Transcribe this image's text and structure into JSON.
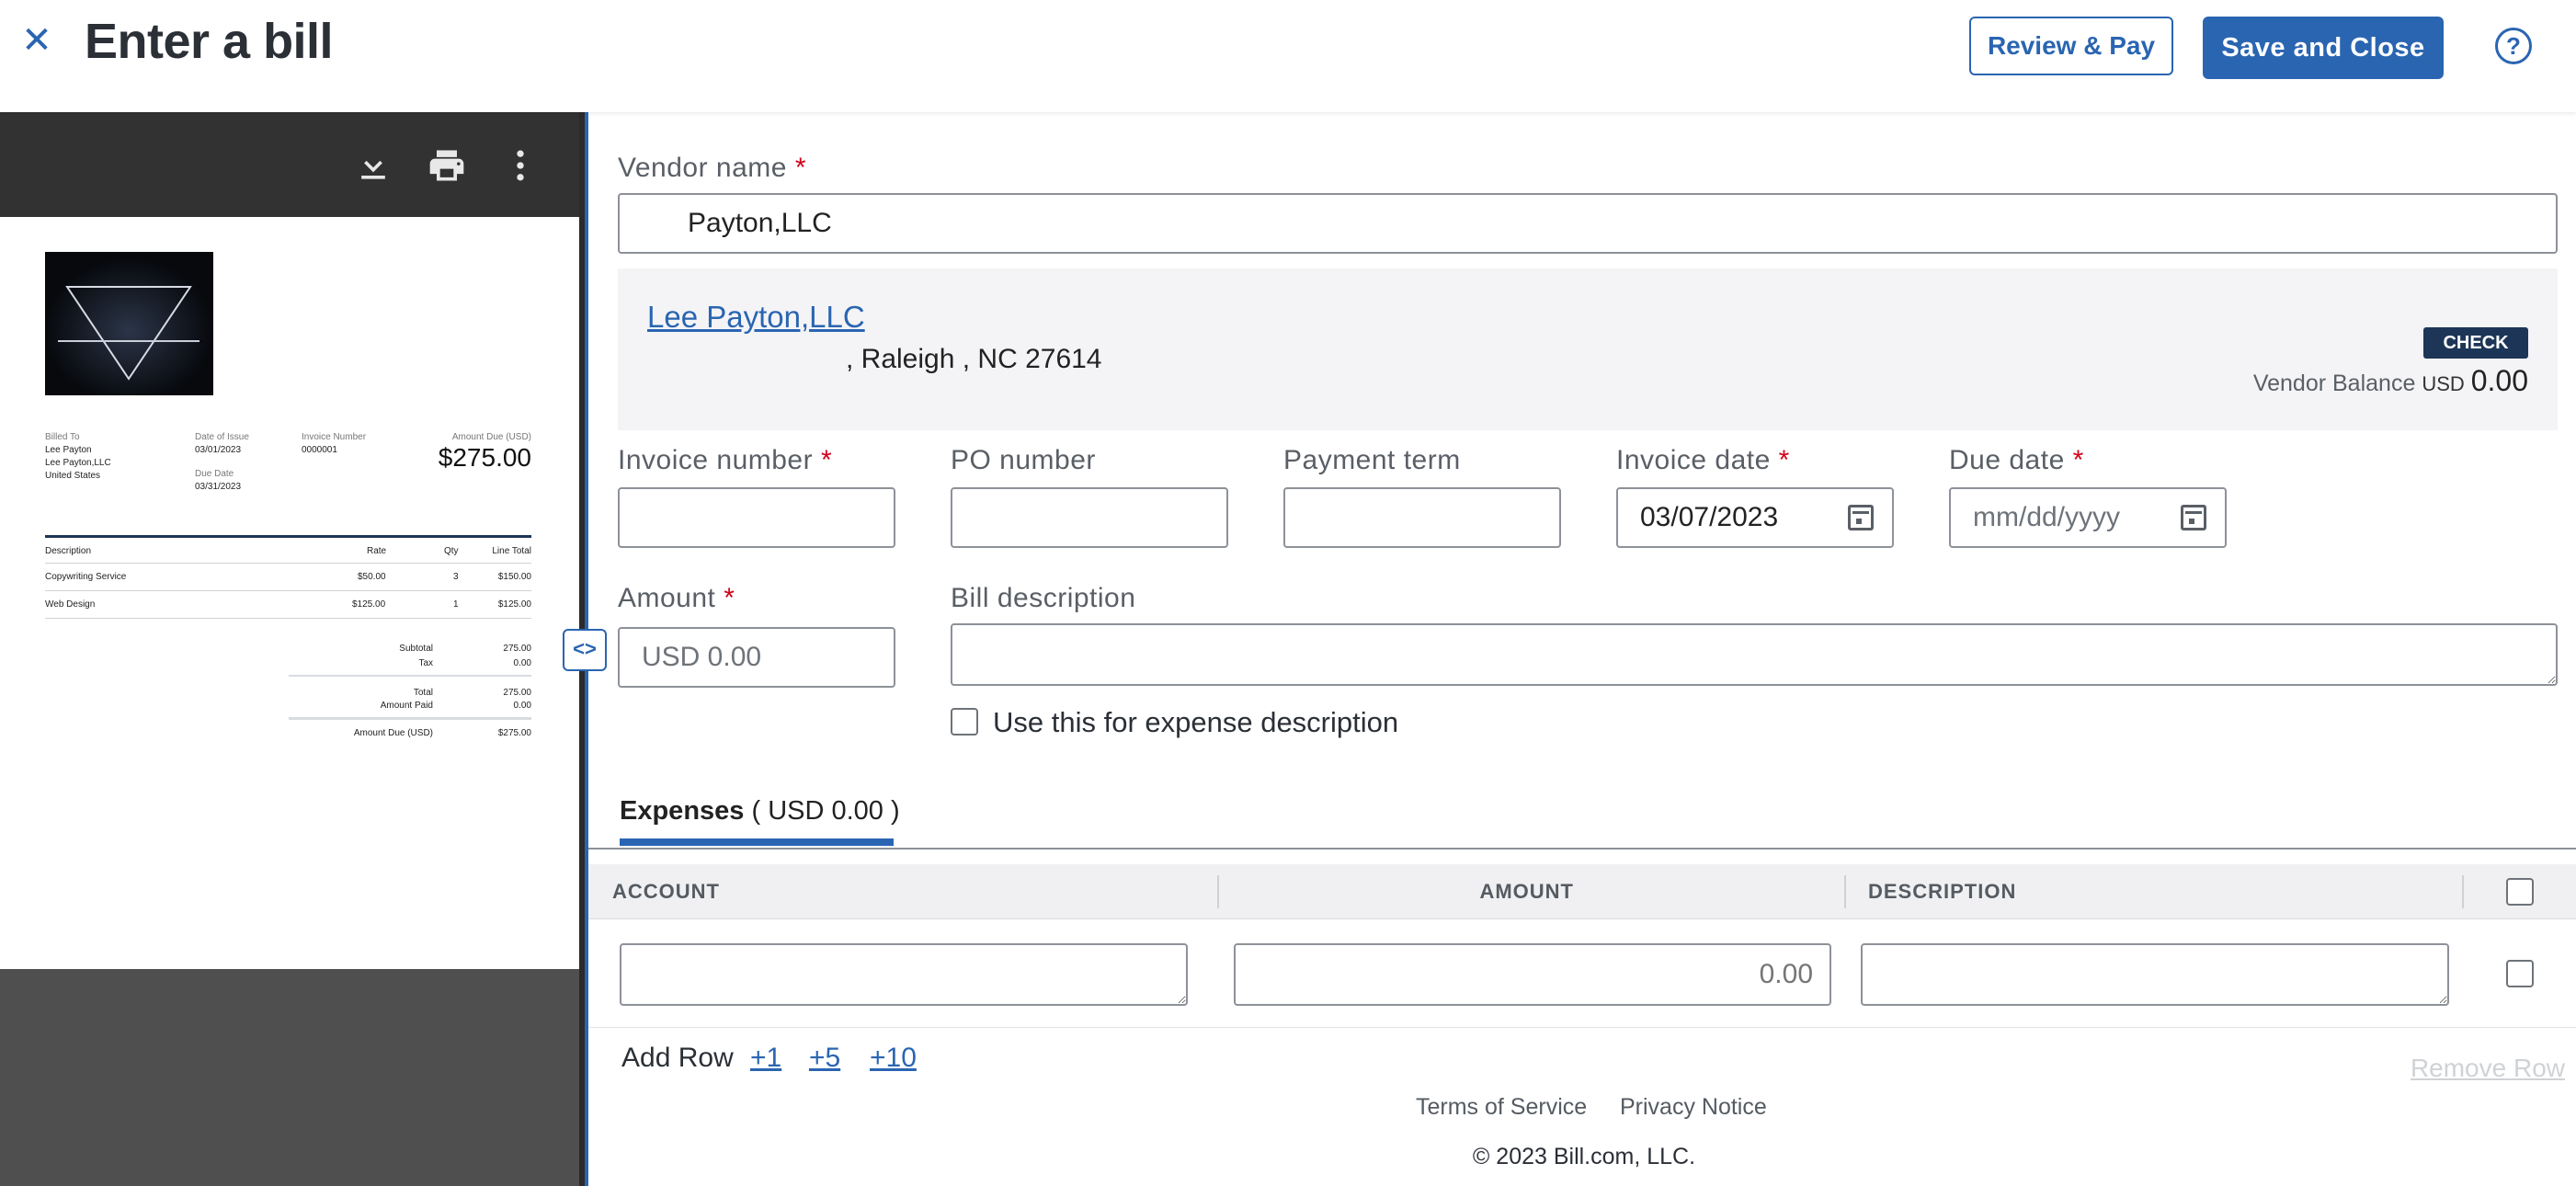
{
  "header": {
    "title": "Enter a bill",
    "review_pay": "Review & Pay",
    "save_close": "Save and Close"
  },
  "viewer": {
    "icons": [
      "download-icon",
      "print-icon",
      "more-vert-icon"
    ],
    "invoice": {
      "billed_to_label": "Billed To",
      "billed_to_lines": [
        "Lee Payton",
        "Lee Payton,LLC",
        "United States"
      ],
      "date_of_issue_label": "Date of Issue",
      "date_of_issue": "03/01/2023",
      "due_date_label": "Due Date",
      "due_date": "03/31/2023",
      "invoice_number_label": "Invoice Number",
      "invoice_number": "0000001",
      "amount_due_label": "Amount Due (USD)",
      "amount_due": "$275.00",
      "columns": [
        "Description",
        "Rate",
        "Qty",
        "Line Total"
      ],
      "items": [
        {
          "description": "Copywriting Service",
          "rate": "$50.00",
          "qty": "3",
          "total": "$150.00"
        },
        {
          "description": "Web Design",
          "rate": "$125.00",
          "qty": "1",
          "total": "$125.00"
        }
      ],
      "subtotal_label": "Subtotal",
      "subtotal": "275.00",
      "tax_label": "Tax",
      "tax": "0.00",
      "total_label": "Total",
      "total": "275.00",
      "amount_paid_label": "Amount Paid",
      "amount_paid": "0.00",
      "amount_due_footer_label": "Amount Due (USD)",
      "amount_due_footer": "$275.00"
    }
  },
  "form": {
    "vendor_name_label": "Vendor name",
    "vendor_name_value": "Payton,LLC",
    "vendor": {
      "name": "Lee Payton,LLC",
      "address": ", Raleigh , NC 27614",
      "badge": "CHECK",
      "balance_label": "Vendor Balance",
      "balance_currency": "USD",
      "balance_value": "0.00"
    },
    "invoice_number_label": "Invoice number",
    "po_number_label": "PO number",
    "payment_term_label": "Payment term",
    "invoice_date_label": "Invoice date",
    "invoice_date_value": "03/07/2023",
    "due_date_label": "Due date",
    "due_date_placeholder": "mm/dd/yyyy",
    "amount_label": "Amount",
    "amount_placeholder": "USD 0.00",
    "bill_description_label": "Bill description",
    "use_for_expense_label": "Use this for expense description",
    "required_mark": "*"
  },
  "expenses": {
    "tab_label": "Expenses",
    "tab_total": "( USD 0.00 )",
    "columns": {
      "account": "ACCOUNT",
      "amount": "AMOUNT",
      "description": "DESCRIPTION"
    },
    "row_amount_placeholder": "0.00",
    "add_row_label": "Add Row",
    "add_links": [
      "+1",
      "+5",
      "+10"
    ],
    "remove_row_label": "Remove Row"
  },
  "footer": {
    "terms": "Terms of Service",
    "privacy": "Privacy Notice",
    "copyright": "© 2023 Bill.com, LLC."
  },
  "colors": {
    "brand": "#2a65b1",
    "badge": "#1d3557",
    "required": "#d0021b"
  }
}
